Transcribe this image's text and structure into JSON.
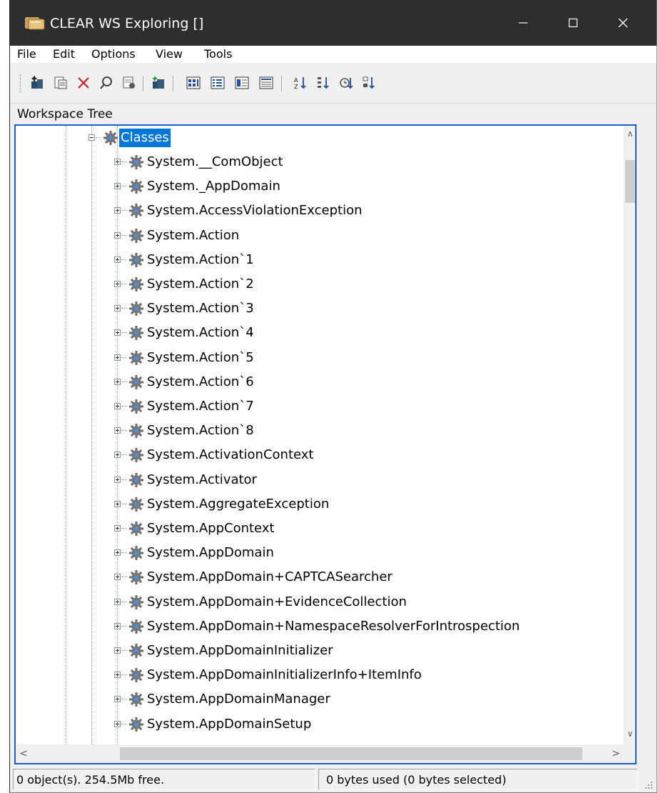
{
  "window": {
    "title": "CLEAR WS Exploring []",
    "controls": {
      "minimize": "–",
      "maximize": "☐",
      "close": "✕"
    }
  },
  "menu": [
    "File",
    "Edit",
    "Options",
    "View",
    "Tools"
  ],
  "toolbar": {
    "groups": [
      [
        "up-folder-icon",
        "properties-icon",
        "delete-icon",
        "find-icon",
        "process-icon"
      ],
      [
        "new-folder-icon"
      ],
      [
        "large-icons-icon",
        "small-icons-icon",
        "list-view-icon",
        "details-view-icon"
      ],
      [
        "sort-ascending-icon",
        "sort-descending-icon",
        "refresh-sort-icon",
        "sort-order-icon"
      ]
    ]
  },
  "panel": {
    "label": "Workspace Tree"
  },
  "tree": {
    "root": {
      "label": "Classes",
      "expanded": true,
      "selected": true
    },
    "children": [
      "System.__ComObject",
      "System._AppDomain",
      "System.AccessViolationException",
      "System.Action",
      "System.Action`1",
      "System.Action`2",
      "System.Action`3",
      "System.Action`4",
      "System.Action`5",
      "System.Action`6",
      "System.Action`7",
      "System.Action`8",
      "System.ActivationContext",
      "System.Activator",
      "System.AggregateException",
      "System.AppContext",
      "System.AppDomain",
      "System.AppDomain+CAPTCASearcher",
      "System.AppDomain+EvidenceCollection",
      "System.AppDomain+NamespaceResolverForIntrospection",
      "System.AppDomainInitializer",
      "System.AppDomainInitializerInfo+ItemInfo",
      "System.AppDomainManager",
      "System.AppDomainSetup"
    ]
  },
  "scrollbars": {
    "up": "∧",
    "down": "∨",
    "left": "<",
    "right": ">"
  },
  "status": {
    "left": "0 object(s). 254.5Mb free.",
    "right": "0 bytes used (0 bytes selected)"
  },
  "colors": {
    "titlebar": "#2e2e2e",
    "selection": "#0078d7",
    "focus_border": "#1a5fc8"
  }
}
